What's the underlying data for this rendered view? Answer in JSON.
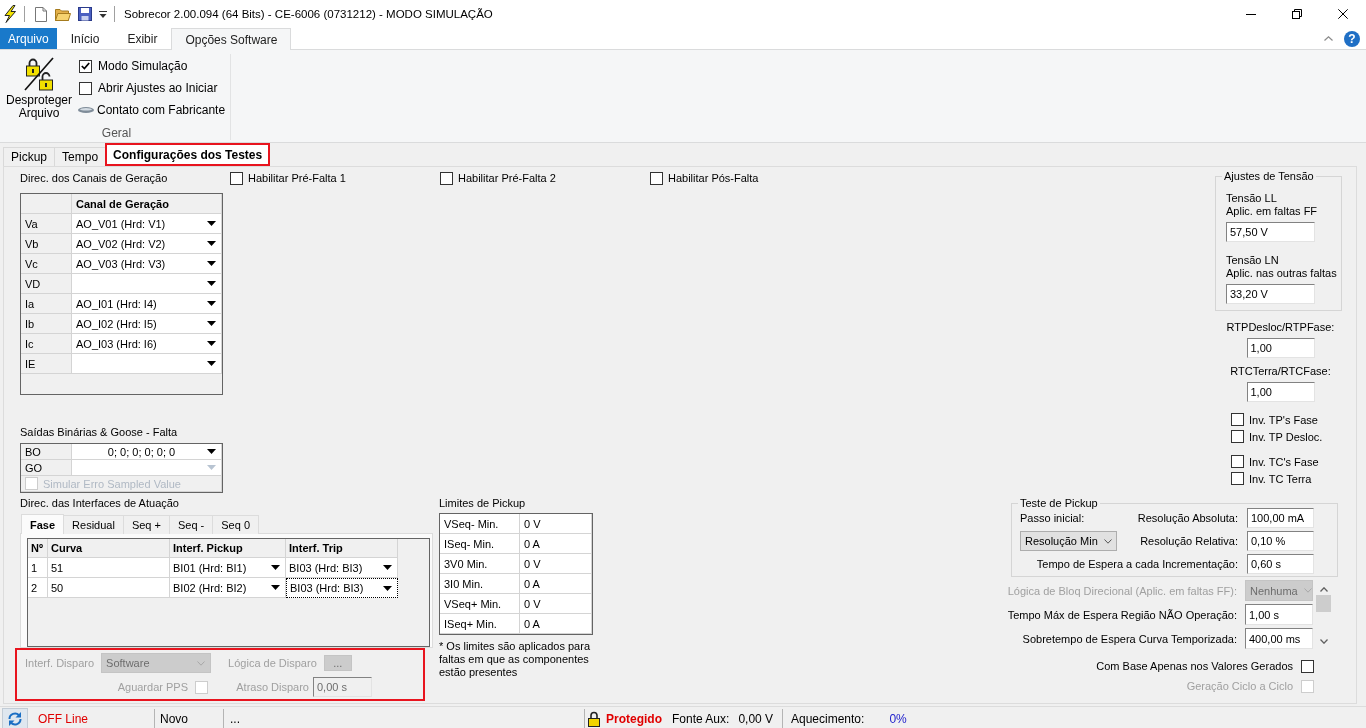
{
  "window": {
    "title": "Sobrecor 2.00.094 (64 Bits) - CE-6006 (0731212) - MODO SIMULAÇÃO"
  },
  "ribbon": {
    "tabs": [
      {
        "label": "Arquivo",
        "kind": "file",
        "selected": false
      },
      {
        "label": "Início",
        "kind": "tab",
        "selected": false
      },
      {
        "label": "Exibir",
        "kind": "tab",
        "selected": false
      },
      {
        "label": "Opções Software",
        "kind": "tab",
        "selected": true
      }
    ],
    "help": "?",
    "group": {
      "label": "Geral",
      "button": "Desproteger Arquivo",
      "items": [
        {
          "kind": "checkbox",
          "label": "Modo Simulação",
          "checked": true
        },
        {
          "kind": "checkbox",
          "label": "Abrir Ajustes ao Iniciar",
          "checked": false
        },
        {
          "kind": "link",
          "label": "Contato com Fabricante"
        }
      ]
    }
  },
  "doc_tabs": [
    {
      "label": "Pickup",
      "selected": false,
      "highlighted": false
    },
    {
      "label": "Tempo",
      "selected": false,
      "highlighted": false
    },
    {
      "label": "Configurações dos Testes",
      "selected": true,
      "highlighted": true
    }
  ],
  "generation": {
    "label": "Direc. dos Canais de Geração",
    "column": "Canal de Geração",
    "rows": [
      {
        "name": "Va",
        "value": "AO_V01 (Hrd: V1)"
      },
      {
        "name": "Vb",
        "value": "AO_V02 (Hrd: V2)"
      },
      {
        "name": "Vc",
        "value": "AO_V03 (Hrd: V3)"
      },
      {
        "name": "VD"
      },
      {
        "name": "Ia",
        "value": "AO_I01 (Hrd: I4)"
      },
      {
        "name": "Ib",
        "value": "AO_I02 (Hrd: I5)"
      },
      {
        "name": "Ic",
        "value": "AO_I03 (Hrd: I6)"
      },
      {
        "name": "IE"
      }
    ]
  },
  "fault_toggles": [
    {
      "label": "Habilitar Pré-Falta 1",
      "checked": false
    },
    {
      "label": "Habilitar Pré-Falta 2",
      "checked": false
    },
    {
      "label": "Habilitar Pós-Falta",
      "checked": false
    }
  ],
  "outputs": {
    "label": "Saídas Binárias & Goose - Falta",
    "rows": [
      {
        "name": "BO",
        "value": "0; 0; 0; 0; 0; 0",
        "disabled": false
      },
      {
        "name": "GO",
        "disabled": true
      }
    ],
    "sampled_value_error": {
      "label": "Simular Erro Sampled Value",
      "checked": false,
      "disabled": true
    }
  },
  "actuation": {
    "label": "Direc. das Interfaces de Atuação",
    "tabs": [
      {
        "label": "Fase",
        "selected": true
      },
      {
        "label": "Residual",
        "selected": false
      },
      {
        "label": "Seq +",
        "selected": false
      },
      {
        "label": "Seq -",
        "selected": false
      },
      {
        "label": "Seq 0",
        "selected": false
      }
    ],
    "columns": [
      "Nº",
      "Curva",
      "Interf. Pickup",
      "Interf. Trip"
    ],
    "rows": [
      {
        "number": "1",
        "curve": "51",
        "pickup": "BI01 (Hrd: BI1)",
        "trip": "BI03 (Hrd: BI3)",
        "trip_focused": false
      },
      {
        "number": "2",
        "curve": "50",
        "pickup": "BI02 (Hrd: BI2)",
        "trip": "BI03 (Hrd: BI3)",
        "trip_focused": true
      }
    ]
  },
  "trip": {
    "highlighted": true,
    "disabled": true,
    "interface_label": "Interf. Disparo",
    "interface_value": "Software",
    "logic_label": "Lógica de Disparo",
    "logic_button": "...",
    "pps_label": "Aguardar PPS",
    "pps_checked": false,
    "delay_label": "Atraso Disparo",
    "delay_value": "0,00 s"
  },
  "pickup_limits": {
    "label": "Limites de Pickup",
    "rows": [
      {
        "name": "VSeq- Min.",
        "value": "0 V"
      },
      {
        "name": "ISeq- Min.",
        "value": "0 A"
      },
      {
        "name": "3V0 Min.",
        "value": "0 V"
      },
      {
        "name": "3I0 Min.",
        "value": "0 A"
      },
      {
        "name": "VSeq+ Min.",
        "value": "0 V"
      },
      {
        "name": "ISeq+ Min.",
        "value": "0 A"
      }
    ],
    "note": "* Os limites são aplicados para faltas em que as componentes estão presentes"
  },
  "voltage": {
    "title": "Ajustes de Tensão",
    "fields": [
      {
        "label": "Tensão LL",
        "hint": "Aplic. em faltas FF",
        "value": "57,50 V"
      },
      {
        "label": "Tensão LN",
        "hint": "Aplic. nas outras faltas",
        "value": "33,20 V"
      }
    ]
  },
  "ratios": [
    {
      "label": "RTPDesloc/RTPFase:",
      "value": "1,00"
    },
    {
      "label": "RTCTerra/RTCFase:",
      "value": "1,00"
    }
  ],
  "inversions": [
    {
      "items": [
        {
          "label": "Inv. TP's Fase",
          "checked": false
        },
        {
          "label": "Inv. TP Desloc.",
          "checked": false
        }
      ]
    },
    {
      "items": [
        {
          "label": "Inv. TC's Fase",
          "checked": false
        },
        {
          "label": "Inv. TC Terra",
          "checked": false
        }
      ]
    }
  ],
  "pickup_test": {
    "title": "Teste de Pickup",
    "step_label": "Passo inicial:",
    "step_value": "Resolução Min",
    "fields": [
      {
        "label": "Resolução Absoluta:",
        "value": "100,00 mA"
      },
      {
        "label": "Resolução Relativa:",
        "value": "0,10 %"
      },
      {
        "label": "Tempo de Espera a cada Incrementação:",
        "value": "0,60 s"
      }
    ]
  },
  "timing": [
    {
      "kind": "select",
      "label": "Lógica de Bloq Direcional (Aplic. em faltas FF):",
      "value": "Nenhuma",
      "disabled": true
    },
    {
      "kind": "field",
      "label": "Tempo Máx de Espera Região NÃO Operação:",
      "value": "1,00 s",
      "disabled": false
    },
    {
      "kind": "field",
      "label": "Sobretempo de Espera Curva Temporizada:",
      "value": "400,00 ms",
      "disabled": false
    }
  ],
  "options": [
    {
      "label": "Com Base Apenas nos Valores Gerados",
      "checked": false,
      "disabled": false
    },
    {
      "label": "Geração Ciclo a Ciclo",
      "checked": false,
      "disabled": true
    }
  ],
  "status_bar": {
    "connection": "OFF Line",
    "file": "Novo",
    "info": "...",
    "protection": "Protegido",
    "aux_label": "Fonte Aux:",
    "aux_value": "0,00 V",
    "heating_label": "Aquecimento:",
    "heating_value": "0%"
  }
}
